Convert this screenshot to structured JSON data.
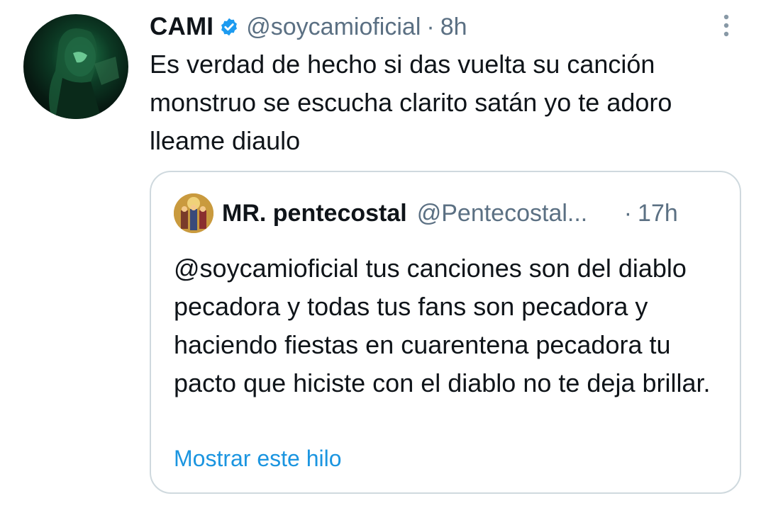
{
  "tweet": {
    "author_name": "CAMI",
    "author_handle": "@soycamioficial",
    "separator": "·",
    "time": "8h",
    "verified": true,
    "text": "Es verdad de hecho si das vuelta su canción monstruo se escucha clarito satán yo te adoro lleame diaulo",
    "more_icon": "more-vertical-icon"
  },
  "quoted_tweet": {
    "author_name": "MR. pentecostal",
    "author_handle": "@Pentecostal...",
    "separator": "·",
    "time": "17h",
    "text": "@soycamioficial tus canciones son del diablo pecadora y todas tus fans son pecadora y haciendo fiestas en cuarentena pecadora tu pacto que hiciste con el diablo no te deja brillar.",
    "show_thread_label": "Mostrar este hilo"
  },
  "colors": {
    "text_primary": "#0f1419",
    "text_secondary": "#5b7083",
    "link": "#1b95e0",
    "verified": "#1d9bf0",
    "border": "#cfd9de"
  }
}
